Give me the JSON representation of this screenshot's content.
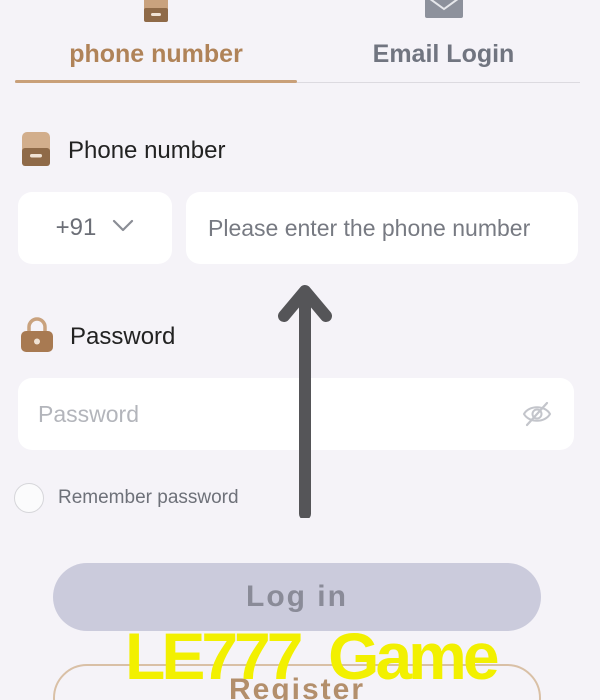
{
  "tabs": [
    {
      "label": "phone number",
      "icon": "phone-icon",
      "active": true
    },
    {
      "label": "Email Login",
      "icon": "email-icon",
      "active": false
    }
  ],
  "phone_section": {
    "label": "Phone number",
    "icon": "phone-icon",
    "country_code": "+91",
    "placeholder": "Please enter the phone number"
  },
  "password_section": {
    "label": "Password",
    "icon": "lock-icon",
    "placeholder": "Password",
    "visibility_icon": "eye-off-icon"
  },
  "remember": {
    "label": "Remember password",
    "checked": false
  },
  "buttons": {
    "login": "Log in",
    "register": "Register"
  },
  "watermark": "LE777  Game",
  "colors": {
    "accent": "#c9a079",
    "active_tab_text": "#b08358",
    "login_button_bg": "#cbcbdc",
    "register_border": "#d9c0a6",
    "watermark": "#f2f000"
  }
}
